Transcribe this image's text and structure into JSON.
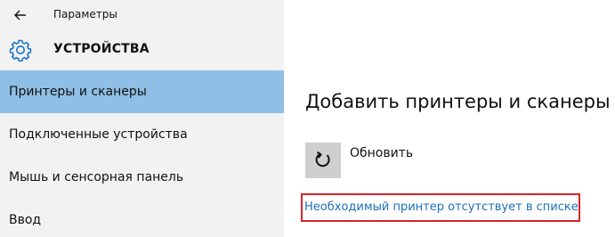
{
  "titlebar": {
    "back_icon": "back-arrow-icon",
    "app_title": "Параметры"
  },
  "header": {
    "icon": "gear-icon",
    "title": "УСТРОЙСТВА"
  },
  "sidebar": {
    "items": [
      {
        "label": "Принтеры и сканеры",
        "selected": true
      },
      {
        "label": "Подключенные устройства",
        "selected": false
      },
      {
        "label": "Мышь и сенсорная панель",
        "selected": false
      },
      {
        "label": "Ввод",
        "selected": false
      }
    ]
  },
  "main": {
    "title": "Добавить принтеры и сканеры",
    "refresh": {
      "icon": "refresh-icon",
      "label": "Обновить"
    },
    "missing_printer_link": "Необходимый принтер отсутствует в списке"
  },
  "colors": {
    "sidebar_bg": "#f2f2f2",
    "selected_bg": "#8fbfe4",
    "accent": "#1e6fb8",
    "highlight_border": "#d9232a"
  }
}
